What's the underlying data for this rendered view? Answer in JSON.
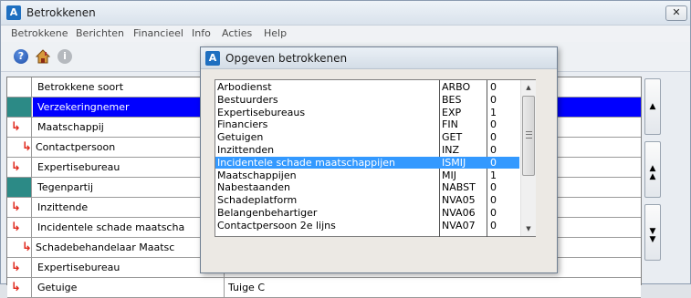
{
  "main": {
    "title": "Betrokkenen",
    "logo_letter": "A",
    "close_glyph": "✕"
  },
  "menu": [
    "Betrokkene",
    "Berichten",
    "Financieel",
    "Info",
    "Acties",
    "Help"
  ],
  "toolbar": {
    "icons": [
      "help-icon",
      "home-icon",
      "info-icon"
    ],
    "help_glyph": "?",
    "info_glyph": "i"
  },
  "grid": {
    "header": "Betrokkene soort",
    "rows": [
      {
        "name": "Verzekeringnemer",
        "extra": "",
        "indicator": "teal",
        "selected": true
      },
      {
        "name": "Maatschappij",
        "extra": "",
        "indicator": "arrow",
        "selected": false
      },
      {
        "name": "Contactpersoon",
        "extra": "",
        "indicator": "arrow-indent",
        "selected": false
      },
      {
        "name": "Expertisebureau",
        "extra": "",
        "indicator": "arrow",
        "selected": false
      },
      {
        "name": "Tegenpartij",
        "extra": "",
        "indicator": "teal",
        "selected": false
      },
      {
        "name": "Inzittende",
        "extra": "",
        "indicator": "arrow",
        "selected": false
      },
      {
        "name": "Incidentele schade maatscha",
        "extra": "",
        "indicator": "arrow",
        "selected": false
      },
      {
        "name": "Schadebehandelaar Maatsc",
        "extra": "",
        "indicator": "arrow-indent",
        "selected": false
      },
      {
        "name": "Expertisebureau",
        "extra": "",
        "indicator": "arrow",
        "selected": false
      },
      {
        "name": "Getuige",
        "extra": "Tuige C",
        "indicator": "arrow",
        "selected": false
      }
    ],
    "side_buttons": [
      "▲",
      "▲\n▲",
      "▼\n▼"
    ]
  },
  "dialog": {
    "title": "Opgeven betrokkenen",
    "logo_letter": "A",
    "items": [
      {
        "name": "Arbodienst",
        "code": "ARBO",
        "count": "0",
        "selected": false
      },
      {
        "name": "Bestuurders",
        "code": "BES",
        "count": "0",
        "selected": false
      },
      {
        "name": "Expertisebureaus",
        "code": "EXP",
        "count": "1",
        "selected": false
      },
      {
        "name": "Financiers",
        "code": "FIN",
        "count": "0",
        "selected": false
      },
      {
        "name": "Getuigen",
        "code": "GET",
        "count": "0",
        "selected": false
      },
      {
        "name": "Inzittenden",
        "code": "INZ",
        "count": "0",
        "selected": false
      },
      {
        "name": "Incidentele schade maatschappijen",
        "code": "ISMIJ",
        "count": "0",
        "selected": true
      },
      {
        "name": "Maatschappijen",
        "code": "MIJ",
        "count": "1",
        "selected": false
      },
      {
        "name": "Nabestaanden",
        "code": "NABST",
        "count": "0",
        "selected": false
      },
      {
        "name": "Schadeplatform",
        "code": "NVA05",
        "count": "0",
        "selected": false
      },
      {
        "name": "Belangenbehartiger",
        "code": "NVA06",
        "count": "0",
        "selected": false
      },
      {
        "name": "Contactpersoon 2e lijns",
        "code": "NVA07",
        "count": "0",
        "selected": false
      }
    ],
    "scroll_up": "▲",
    "scroll_down": "▼"
  }
}
